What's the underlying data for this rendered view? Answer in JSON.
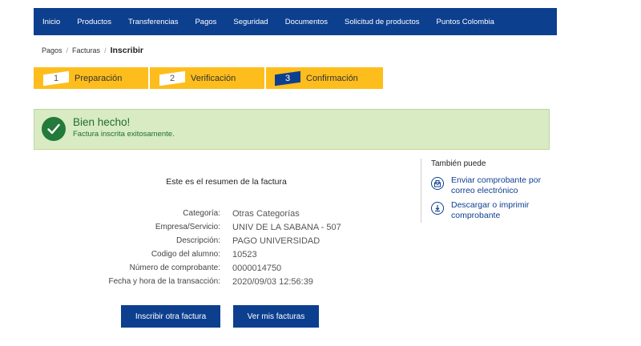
{
  "nav": {
    "items": [
      "Inicio",
      "Productos",
      "Transferencias",
      "Pagos",
      "Seguridad",
      "Documentos",
      "Solicitud de productos",
      "Puntos Colombia"
    ]
  },
  "breadcrumb": {
    "items": [
      "Pagos",
      "Facturas"
    ],
    "current": "Inscribir"
  },
  "steps": [
    {
      "number": "1",
      "label": "Preparación",
      "state": "todo"
    },
    {
      "number": "2",
      "label": "Verificación",
      "state": "todo"
    },
    {
      "number": "3",
      "label": "Confirmación",
      "state": "current"
    }
  ],
  "alert": {
    "title": "Bien hecho!",
    "message": "Factura inscrita exitosamente.",
    "icon": "check-circle-icon"
  },
  "summary": {
    "title": "Este es el resumen de la factura",
    "rows": [
      {
        "label": "Categoría:",
        "value": "Otras Categorías"
      },
      {
        "label": "Empresa/Servicio:",
        "value": "UNIV DE LA SABANA - 507"
      },
      {
        "label": "Descripción:",
        "value": "PAGO UNIVERSIDAD"
      },
      {
        "label": "Codigo del alumno:",
        "value": "10523"
      },
      {
        "label": "Número de comprobante:",
        "value": "0000014750"
      },
      {
        "label": "Fecha y hora de la transacción:",
        "value": "2020/09/03 12:56:39"
      }
    ]
  },
  "buttons": {
    "register_another": "Inscribir otra factura",
    "view_invoices": "Ver mis facturas"
  },
  "sidebar": {
    "title": "También puede",
    "actions": [
      {
        "label": "Enviar comprobante por correo electrónico",
        "icon": "email-receipt-icon"
      },
      {
        "label": "Descargar o imprimir comprobante",
        "icon": "download-icon"
      }
    ]
  },
  "colors": {
    "primary": "#0d3f8f",
    "accent": "#fdbd1c",
    "success_bg": "#d8ebc3",
    "success_text": "#1f6f31"
  }
}
